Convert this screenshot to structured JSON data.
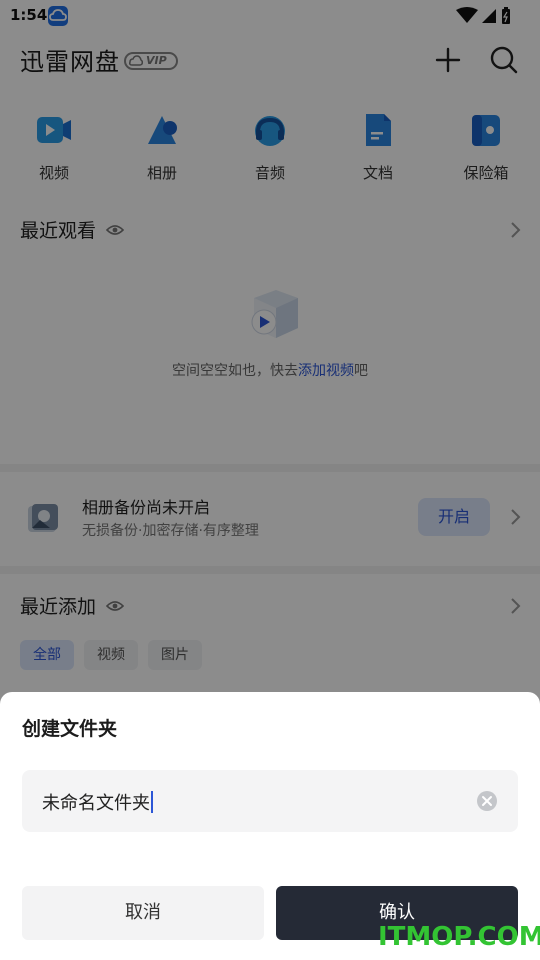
{
  "status_bar": {
    "time": "1:54"
  },
  "header": {
    "title": "迅雷网盘",
    "vip_badge": "VIP"
  },
  "categories": [
    {
      "label": "视频",
      "icon": "video-icon"
    },
    {
      "label": "相册",
      "icon": "album-icon"
    },
    {
      "label": "音频",
      "icon": "audio-icon"
    },
    {
      "label": "文档",
      "icon": "document-icon"
    },
    {
      "label": "保险箱",
      "icon": "safe-icon"
    }
  ],
  "recent_watch": {
    "title": "最近观看",
    "empty_text": "空间空空如也，快去",
    "empty_link": "添加视频",
    "empty_suffix": "吧"
  },
  "backup": {
    "title": "相册备份尚未开启",
    "subtitle": "无损备份·加密存储·有序整理",
    "button": "开启"
  },
  "recent_add": {
    "title": "最近添加",
    "filters": [
      "全部",
      "视频",
      "图片"
    ],
    "active_filter": 0
  },
  "dialog": {
    "title": "创建文件夹",
    "input_value": "未命名文件夹",
    "cancel": "取消",
    "confirm": "确认"
  },
  "watermark": "ITMOP.COM",
  "colors": {
    "accent": "#2c56d6",
    "confirm_bg": "#252a36",
    "overlay": "rgba(0,0,0,0.45)",
    "watermark": "#33c433"
  }
}
